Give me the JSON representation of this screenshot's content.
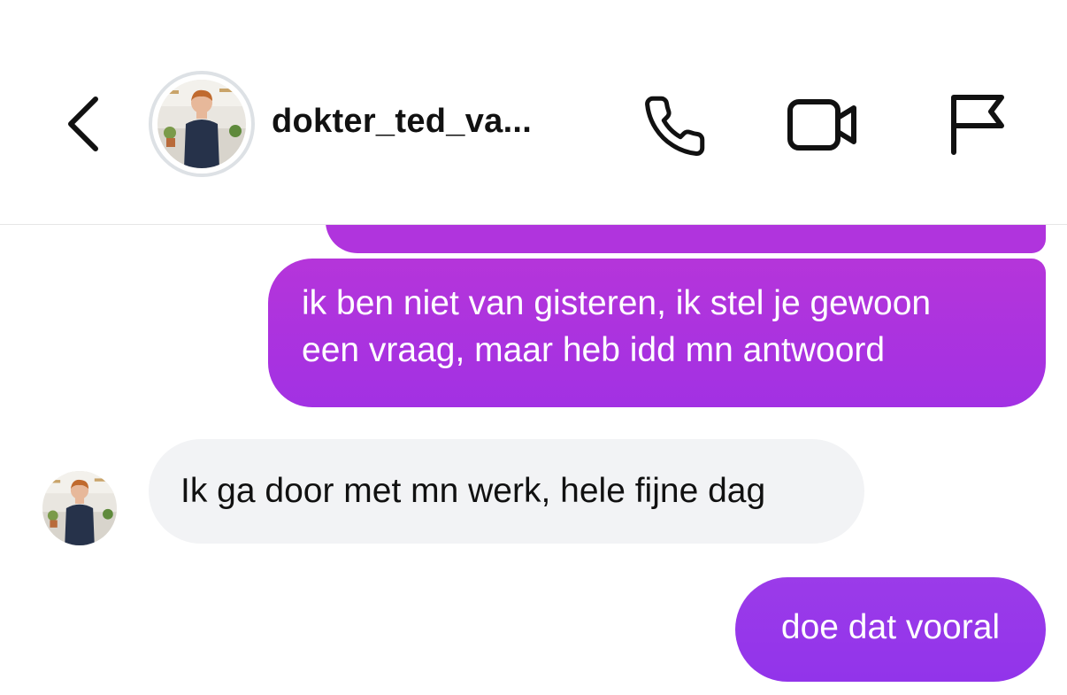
{
  "header": {
    "back_icon": "chevron-left-icon",
    "contact_name": "dokter_ted_va...",
    "actions": [
      "phone-icon",
      "video-camera-icon",
      "flag-icon"
    ]
  },
  "messages": [
    {
      "direction": "outgoing",
      "lines": [
        "ik ben niet van gisteren, ik stel je gewoon",
        "een vraag, maar heb idd mn antwoord"
      ]
    },
    {
      "direction": "incoming",
      "text": "Ik ga door met mn werk, hele fijne dag"
    },
    {
      "direction": "outgoing",
      "text": "doe dat vooral"
    }
  ],
  "colors": {
    "outgoing_bubble": "#b034dd",
    "outgoing_bubble_latest": "#9634ea",
    "incoming_bubble": "#f2f3f5",
    "text_dark": "#111111"
  }
}
